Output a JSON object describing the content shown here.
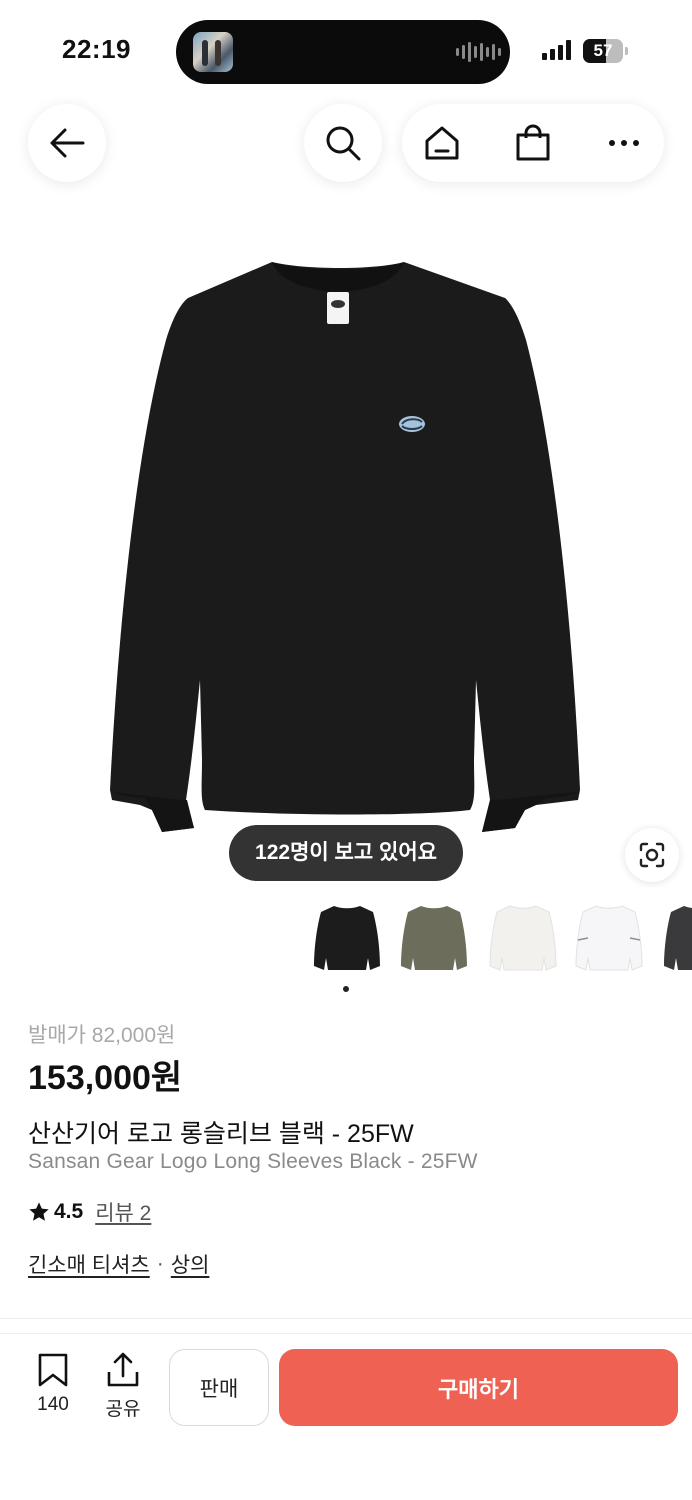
{
  "status_bar": {
    "time": "22:19",
    "battery": "57",
    "battery_level": 0.57
  },
  "nav": {
    "icons": [
      "back-arrow-icon",
      "search-icon",
      "home-icon",
      "shopping-bag-icon",
      "more-icon"
    ]
  },
  "product_image": {
    "viewing_badge": "122명이 보고 있어요",
    "thumbnail_colors": [
      "#1c1c1c",
      "#6c6d5a",
      "#f2f1ee",
      "#f6f6f8",
      "#3a3a3c"
    ]
  },
  "product": {
    "retail_price": "발매가 82,000원",
    "price": "153,000원",
    "name_ko": "산산기어 로고 롱슬리브 블랙 - 25FW",
    "name_en": "Sansan Gear Logo Long Sleeves Black - 25FW",
    "rating": "4.5",
    "review_link": "리뷰 2",
    "category_primary": "긴소매 티셔츠",
    "category_separator": "·",
    "category_secondary": "상의"
  },
  "bottom_bar": {
    "bookmark_count": "140",
    "share_label": "공유",
    "sell_label": "판매",
    "buy_label": "구매하기",
    "buy_color": "#ef6253"
  }
}
